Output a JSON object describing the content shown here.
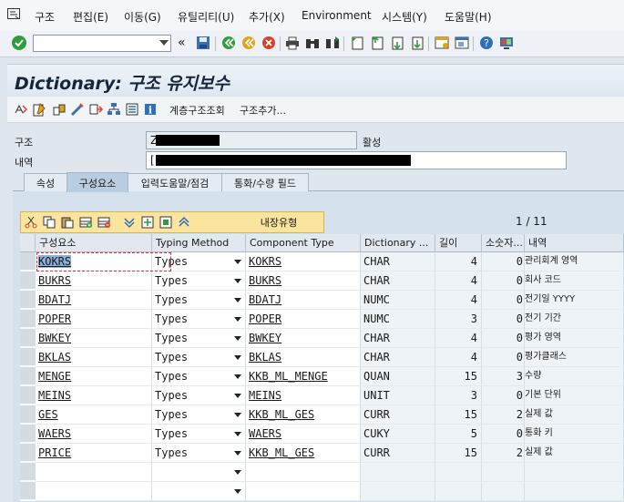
{
  "menu": [
    "구조",
    "편집(E)",
    "이동(G)",
    "유틸리티(U)",
    "추가(X)",
    "Environment",
    "시스템(Y)",
    "도움말(H)"
  ],
  "toolbar": {
    "command_value": "",
    "back_label": "«"
  },
  "title": "Dictionary: 구조 유지보수",
  "app_toolbar": {
    "hierarchy_label": "계층구조조회",
    "append_label": "구조추가..."
  },
  "header": {
    "struct_label": "구조",
    "struct_value": "Z",
    "status": "활성",
    "desc_label": "내역",
    "desc_value": "["
  },
  "tabs": [
    "속성",
    "구성요소",
    "입력도움말/점검",
    "통화/수량 필드"
  ],
  "active_tab": 1,
  "table_toolbar": {
    "builtin_label": "내장유형"
  },
  "pagination": "1  /  11",
  "columns": [
    "구성요소",
    "Typing Method",
    "Component Type",
    "Dictionary ...",
    "길이",
    "소숫자...",
    "내역"
  ],
  "rows": [
    {
      "name": "KOKRS",
      "method": "Types",
      "comp": "KOKRS",
      "dtype": "CHAR",
      "len": "4",
      "dec": "0",
      "desc": "관리회계 영역"
    },
    {
      "name": "BUKRS",
      "method": "Types",
      "comp": "BUKRS",
      "dtype": "CHAR",
      "len": "4",
      "dec": "0",
      "desc": "회사 코드"
    },
    {
      "name": "BDATJ",
      "method": "Types",
      "comp": "BDATJ",
      "dtype": "NUMC",
      "len": "4",
      "dec": "0",
      "desc": "전기일 YYYY"
    },
    {
      "name": "POPER",
      "method": "Types",
      "comp": "POPER",
      "dtype": "NUMC",
      "len": "3",
      "dec": "0",
      "desc": "전기 기간"
    },
    {
      "name": "BWKEY",
      "method": "Types",
      "comp": "BWKEY",
      "dtype": "CHAR",
      "len": "4",
      "dec": "0",
      "desc": "평가 영역"
    },
    {
      "name": "BKLAS",
      "method": "Types",
      "comp": "BKLAS",
      "dtype": "CHAR",
      "len": "4",
      "dec": "0",
      "desc": "평가클래스"
    },
    {
      "name": "MENGE",
      "method": "Types",
      "comp": "KKB_ML_MENGE",
      "dtype": "QUAN",
      "len": "15",
      "dec": "3",
      "desc": "수량"
    },
    {
      "name": "MEINS",
      "method": "Types",
      "comp": "MEINS",
      "dtype": "UNIT",
      "len": "3",
      "dec": "0",
      "desc": "기본 단위"
    },
    {
      "name": "GES",
      "method": "Types",
      "comp": "KKB_ML_GES",
      "dtype": "CURR",
      "len": "15",
      "dec": "2",
      "desc": "실제 값"
    },
    {
      "name": "WAERS",
      "method": "Types",
      "comp": "WAERS",
      "dtype": "CUKY",
      "len": "5",
      "dec": "0",
      "desc": "통화 키"
    },
    {
      "name": "PRICE",
      "method": "Types",
      "comp": "KKB_ML_GES",
      "dtype": "CURR",
      "len": "15",
      "dec": "2",
      "desc": "실제 값"
    }
  ]
}
